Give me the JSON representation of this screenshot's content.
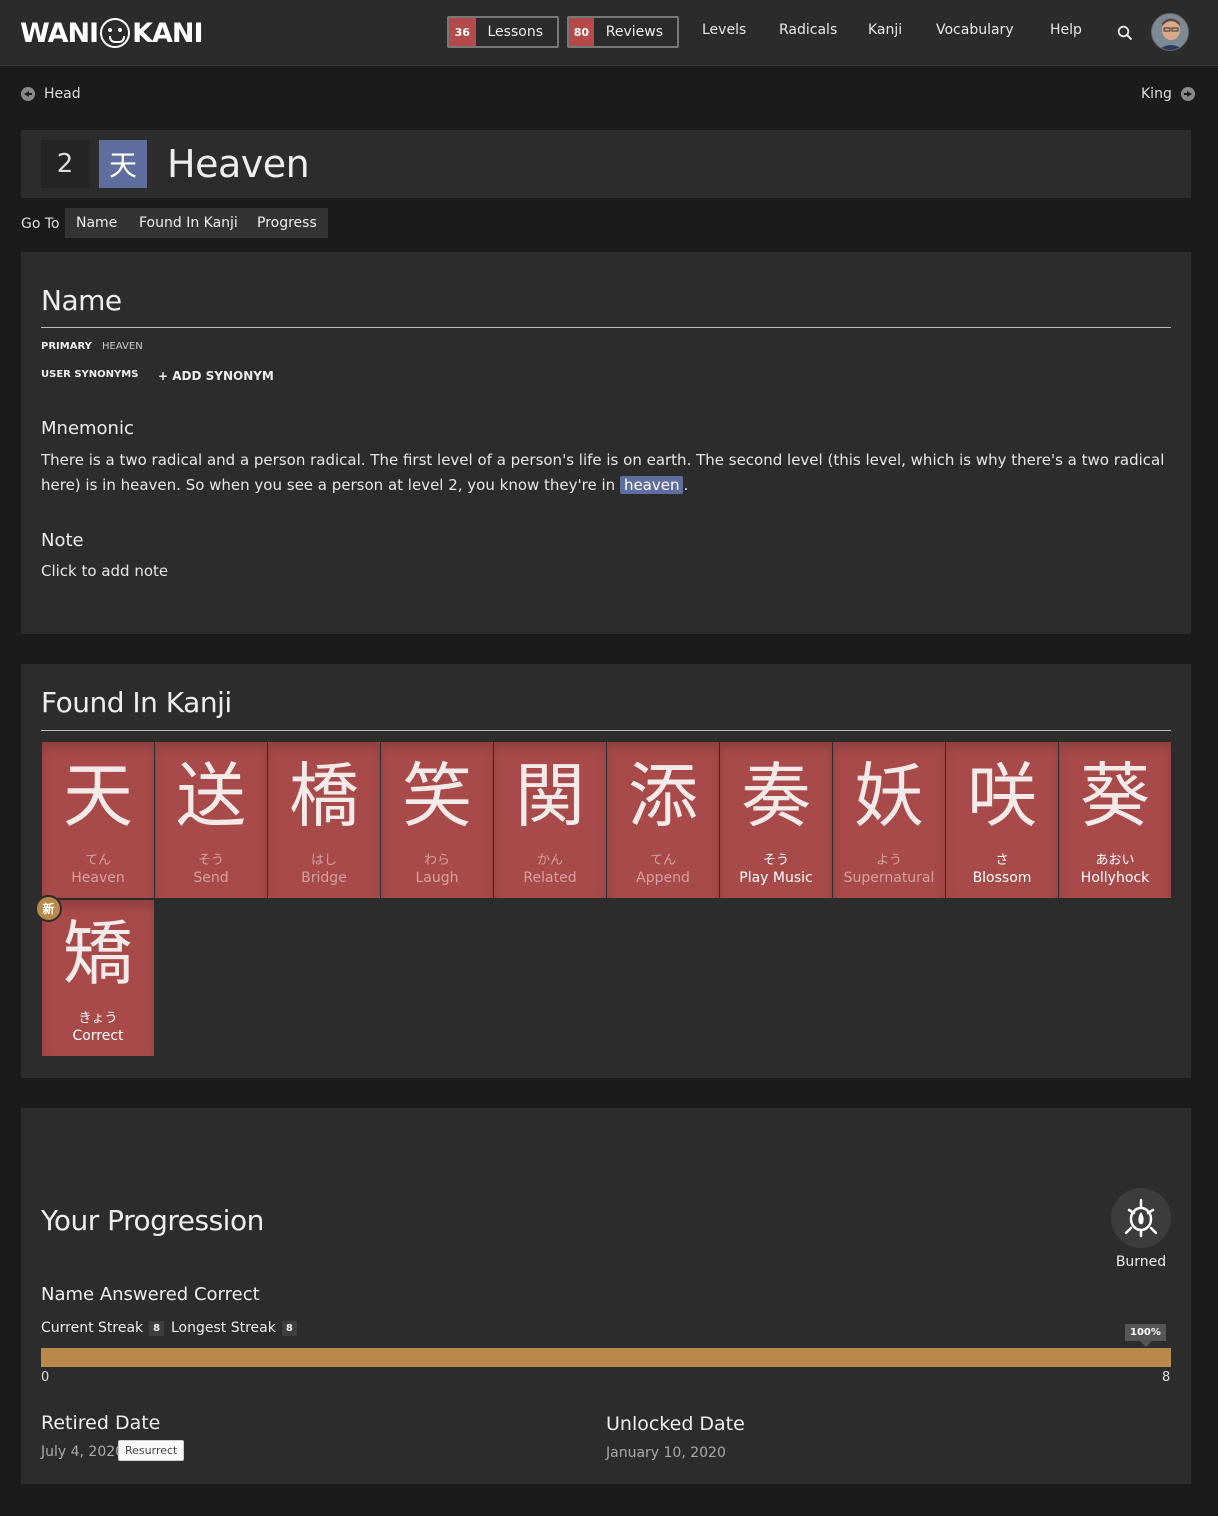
{
  "nav": {
    "logo_left": "WANI",
    "logo_right": "KANI",
    "lessons_count": "36",
    "lessons_label": "Lessons",
    "reviews_count": "80",
    "reviews_label": "Reviews",
    "links": [
      "Levels",
      "Radicals",
      "Kanji",
      "Vocabulary",
      "Help"
    ],
    "icons": {
      "search": "search-icon",
      "avatar": "avatar"
    }
  },
  "pager": {
    "prev": "Head",
    "next": "King"
  },
  "header": {
    "level": "2",
    "character": "天",
    "title": "Heaven"
  },
  "goto": {
    "label": "Go To",
    "buttons": [
      "Name",
      "Found In Kanji",
      "Progress"
    ]
  },
  "name_section": {
    "title": "Name",
    "primary_label": "PRIMARY",
    "primary_value": "HEAVEN",
    "synonyms_label": "USER SYNONYMS",
    "add_synonym": "+ ADD SYNONYM",
    "mnemonic_title": "Mnemonic",
    "mnemonic_before": "There is a two radical and a person radical. The first level of a person's life is on earth. The second level (this level, which is why there's a two radical here) is in heaven. So when you see a person at level 2, you know they're in ",
    "mnemonic_highlight": "heaven",
    "mnemonic_after": ".",
    "note_title": "Note",
    "note_placeholder": "Click to add note"
  },
  "found_in_kanji": {
    "title": "Found In Kanji",
    "items": [
      {
        "kanji": "天",
        "reading": "てん",
        "meaning": "Heaven"
      },
      {
        "kanji": "送",
        "reading": "そう",
        "meaning": "Send"
      },
      {
        "kanji": "橋",
        "reading": "はし",
        "meaning": "Bridge"
      },
      {
        "kanji": "笑",
        "reading": "わら",
        "meaning": "Laugh"
      },
      {
        "kanji": "関",
        "reading": "かん",
        "meaning": "Related"
      },
      {
        "kanji": "添",
        "reading": "てん",
        "meaning": "Append"
      },
      {
        "kanji": "奏",
        "reading": "そう",
        "meaning": "Play Music"
      },
      {
        "kanji": "妖",
        "reading": "よう",
        "meaning": "Supernatural"
      },
      {
        "kanji": "咲",
        "reading": "さ",
        "meaning": "Blossom"
      },
      {
        "kanji": "葵",
        "reading": "あおい",
        "meaning": "Hollyhock"
      },
      {
        "kanji": "矯",
        "reading": "きょう",
        "meaning": "Correct"
      }
    ],
    "new_badge": "新"
  },
  "progression": {
    "title": "Your Progression",
    "srs_stage": "Burned",
    "answered_title": "Name Answered Correct",
    "current_streak_label": "Current Streak",
    "current_streak": "8",
    "longest_streak_label": "Longest Streak",
    "longest_streak": "8",
    "percent_label": "100%",
    "progress_fraction": 1.0,
    "min": "0",
    "max": "8",
    "retired_title": "Retired Date",
    "retired_date": "July 4, 2020",
    "resurrect_label": "Resurrect",
    "unlocked_title": "Unlocked Date",
    "unlocked_date": "January 10, 2020"
  },
  "colors": {
    "radical": "#5f6e9e",
    "kanji": "#a84a4a",
    "burned": "#b8894a",
    "badge": "#b54a4a"
  }
}
